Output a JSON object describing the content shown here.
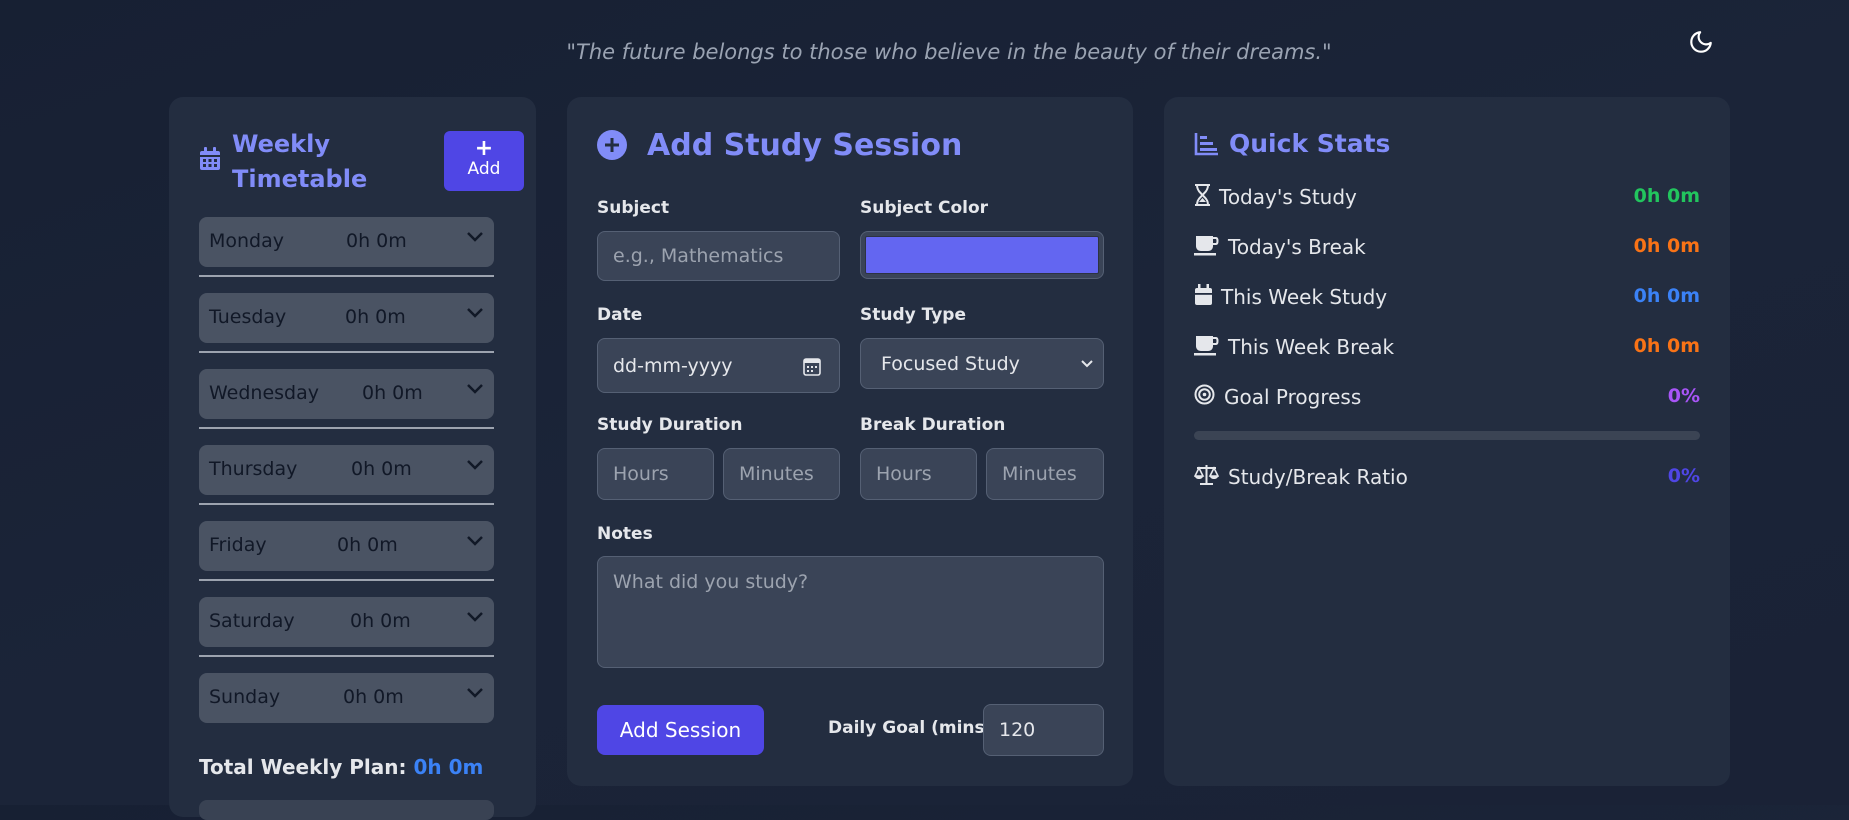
{
  "quote": "\"The future belongs to those who believe in the beauty of their dreams.\"",
  "timetable": {
    "title": "Weekly Timetable",
    "add_label": "Add",
    "days": [
      {
        "name": "Monday",
        "hours": "0h 0m"
      },
      {
        "name": "Tuesday",
        "hours": "0h 0m"
      },
      {
        "name": "Wednesday",
        "hours": "0h 0m"
      },
      {
        "name": "Thursday",
        "hours": "0h 0m"
      },
      {
        "name": "Friday",
        "hours": "0h 0m"
      },
      {
        "name": "Saturday",
        "hours": "0h 0m"
      },
      {
        "name": "Sunday",
        "hours": "0h 0m"
      }
    ],
    "total_label": "Total Weekly Plan:",
    "total_value": "0h 0m"
  },
  "session": {
    "title": "Add Study Session",
    "subject_label": "Subject",
    "subject_placeholder": "e.g., Mathematics",
    "color_label": "Subject Color",
    "color_value": "#6366f1",
    "date_label": "Date",
    "date_placeholder": "dd-mm-yyyy",
    "type_label": "Study Type",
    "type_value": "Focused Study",
    "study_duration_label": "Study Duration",
    "break_duration_label": "Break Duration",
    "hours_placeholder": "Hours",
    "minutes_placeholder": "Minutes",
    "notes_label": "Notes",
    "notes_placeholder": "What did you study?",
    "add_session_label": "Add Session",
    "daily_goal_label": "Daily Goal (mins)",
    "daily_goal_value": "120"
  },
  "stats": {
    "title": "Quick Stats",
    "items": [
      {
        "label": "Today's Study",
        "value": "0h 0m",
        "color": "#22c55e",
        "icon": "hourglass-icon"
      },
      {
        "label": "Today's Break",
        "value": "0h 0m",
        "color": "#f97316",
        "icon": "coffee-icon"
      },
      {
        "label": "This Week Study",
        "value": "0h 0m",
        "color": "#3b82f6",
        "icon": "calendar-icon"
      },
      {
        "label": "This Week Break",
        "value": "0h 0m",
        "color": "#f97316",
        "icon": "coffee-icon"
      },
      {
        "label": "Goal Progress",
        "value": "0%",
        "color": "#a855f7",
        "icon": "target-icon"
      },
      {
        "label": "Study/Break Ratio",
        "value": "0%",
        "color": "#4f46e5",
        "icon": "balance-scale-icon"
      }
    ],
    "goal_progress_fraction": 0
  },
  "colors": {
    "accent": "#818cf8",
    "primary_button": "#4f46e5"
  }
}
